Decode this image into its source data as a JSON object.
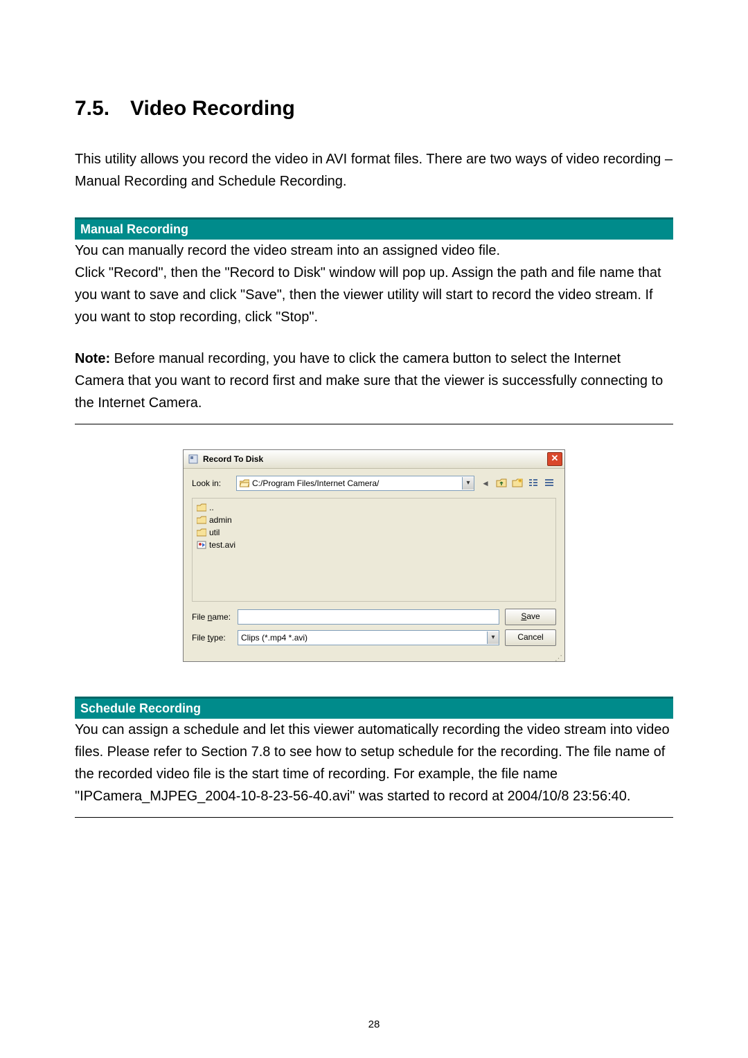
{
  "heading": {
    "num": "7.5.",
    "title": "Video Recording"
  },
  "intro": "This utility allows you record the video in AVI format files. There are two ways of video recording – Manual Recording and Schedule Recording.",
  "manual": {
    "band": "Manual Recording",
    "p1": "You can manually record the video stream into an assigned video file.",
    "p2": "Click \"Record\", then the \"Record to Disk\" window will pop up. Assign the path and file name that you want to save and click \"Save\", then the viewer utility will start to record the video stream. If you want to stop recording, click \"Stop\".",
    "note_label": "Note:",
    "note": " Before manual recording, you have to click the camera button to select the Internet Camera that you want to record first and make sure that the viewer is successfully connecting to the Internet Camera."
  },
  "dialog": {
    "title": "Record To Disk",
    "lookin_label": "Look in:",
    "lookin_value": "C:/Program Files/Internet Camera/",
    "files": [
      {
        "kind": "folder",
        "name": ".."
      },
      {
        "kind": "folder",
        "name": "admin"
      },
      {
        "kind": "folder",
        "name": "util"
      },
      {
        "kind": "file",
        "name": "test.avi"
      }
    ],
    "filename_label_pre": "File ",
    "filename_label_u": "n",
    "filename_label_post": "ame:",
    "filename_value": "",
    "filetype_label_pre": "File ",
    "filetype_label_u": "t",
    "filetype_label_post": "ype:",
    "filetype_value": "Clips (*.mp4 *.avi)",
    "save_btn_u": "S",
    "save_btn_rest": "ave",
    "cancel_btn": "Cancel"
  },
  "schedule": {
    "band": "Schedule Recording",
    "p": "You can assign a schedule and let this viewer automatically recording the video stream into video files. Please refer to Section 7.8 to see how to setup schedule for the recording. The file name of the recorded video file is the start time of recording. For example, the file name \"IPCamera_MJPEG_2004-10-8-23-56-40.avi\" was started to record at 2004/10/8 23:56:40."
  },
  "page_number": "28"
}
